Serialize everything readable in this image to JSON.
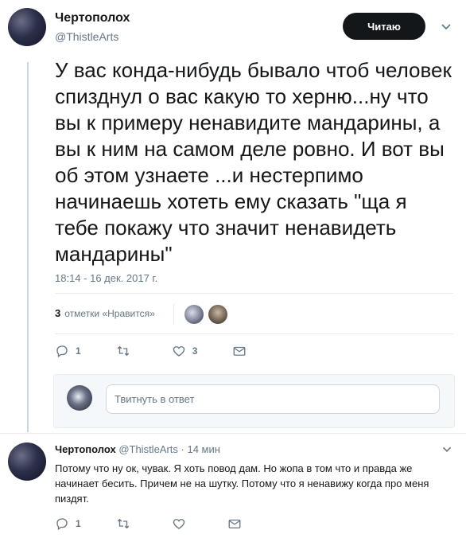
{
  "tweet": {
    "author_name": "Чертополох",
    "author_handle": "@ThistleArts",
    "follow_label": "Читаю",
    "text": "У вас конда-нибудь бывало чтоб человек спизднул о вас какую то херню...ну что вы к примеру ненавидите мандарины, а вы к ним на самом деле ровно. И вот вы об этом узнаете ...и нестерпимо начинаешь хотеть ему сказать \"ща я тебе покажу что значит ненавидеть мандарины\"",
    "timestamp": "18:14 - 16 дек. 2017 г.",
    "likes_count": "3",
    "likes_label": "отметки «Нравится»",
    "actions": {
      "replies": "1",
      "retweets": "",
      "likes": "3"
    }
  },
  "reply_box": {
    "placeholder": "Твитнуть в ответ"
  },
  "reply": {
    "author_name": "Чертополох",
    "author_handle": "@ThistleArts",
    "time": "· 14 мин",
    "text": "Потому что ну ок, чувак. Я хоть повод дам. Но жопа в том что и правда же начинает бесить. Причем не на шутку. Потому что я ненавижу когда про меня пиздят.",
    "actions": {
      "replies": "1",
      "retweets": "",
      "likes": ""
    }
  },
  "colors": {
    "text": "#14171a",
    "muted": "#657786",
    "border": "#e6ecf0",
    "button_bg": "#14171a"
  },
  "icons": [
    "reply-icon",
    "retweet-icon",
    "like-icon",
    "message-icon",
    "chevron-down-icon"
  ]
}
